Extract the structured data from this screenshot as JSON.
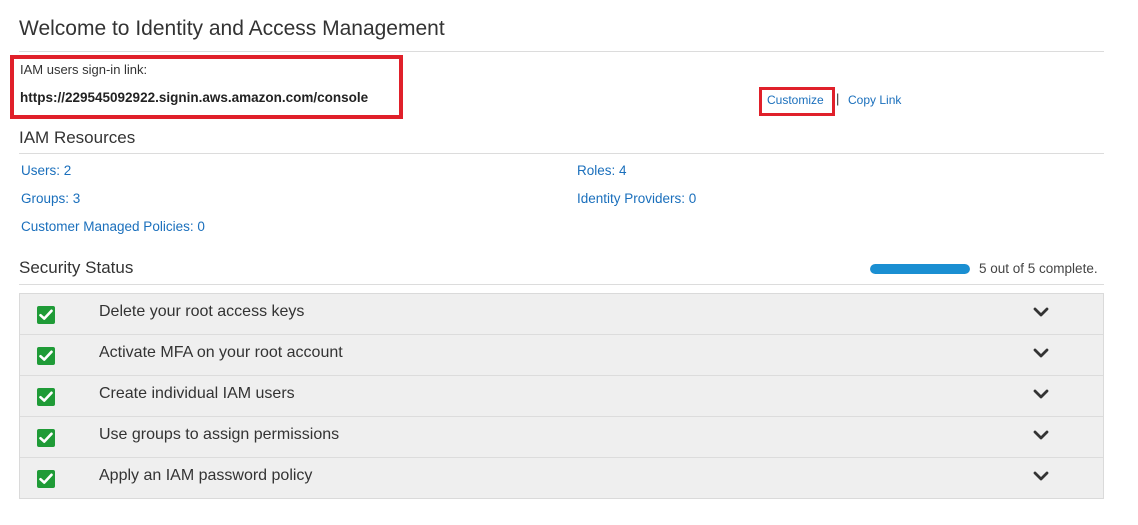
{
  "page": {
    "title": "Welcome to Identity and Access Management"
  },
  "signin": {
    "label": "IAM users sign-in link:",
    "url": "https://229545092922.signin.aws.amazon.com/console",
    "customize_label": "Customize",
    "separator": "|",
    "copy_link_label": "Copy Link"
  },
  "resources": {
    "title": "IAM Resources",
    "items": [
      {
        "label": "Users: 2"
      },
      {
        "label": "Roles: 4"
      },
      {
        "label": "Groups: 3"
      },
      {
        "label": "Identity Providers: 0"
      },
      {
        "label": "Customer Managed Policies: 0"
      }
    ]
  },
  "security": {
    "title": "Security Status",
    "progress_fraction": 1.0,
    "progress_text": "5 out of 5 complete.",
    "items": [
      {
        "label": "Delete your root access keys",
        "status": "complete",
        "icon": "check-icon"
      },
      {
        "label": "Activate MFA on your root account",
        "status": "complete",
        "icon": "check-icon"
      },
      {
        "label": "Create individual IAM users",
        "status": "complete",
        "icon": "check-icon"
      },
      {
        "label": "Use groups to assign permissions",
        "status": "complete",
        "icon": "check-icon"
      },
      {
        "label": "Apply an IAM password policy",
        "status": "complete",
        "icon": "check-icon"
      }
    ]
  },
  "colors": {
    "link": "#1a6fbc",
    "highlight_border": "#e0202a",
    "check_green": "#1f9b37",
    "progress_fill": "#1a8fd2"
  }
}
